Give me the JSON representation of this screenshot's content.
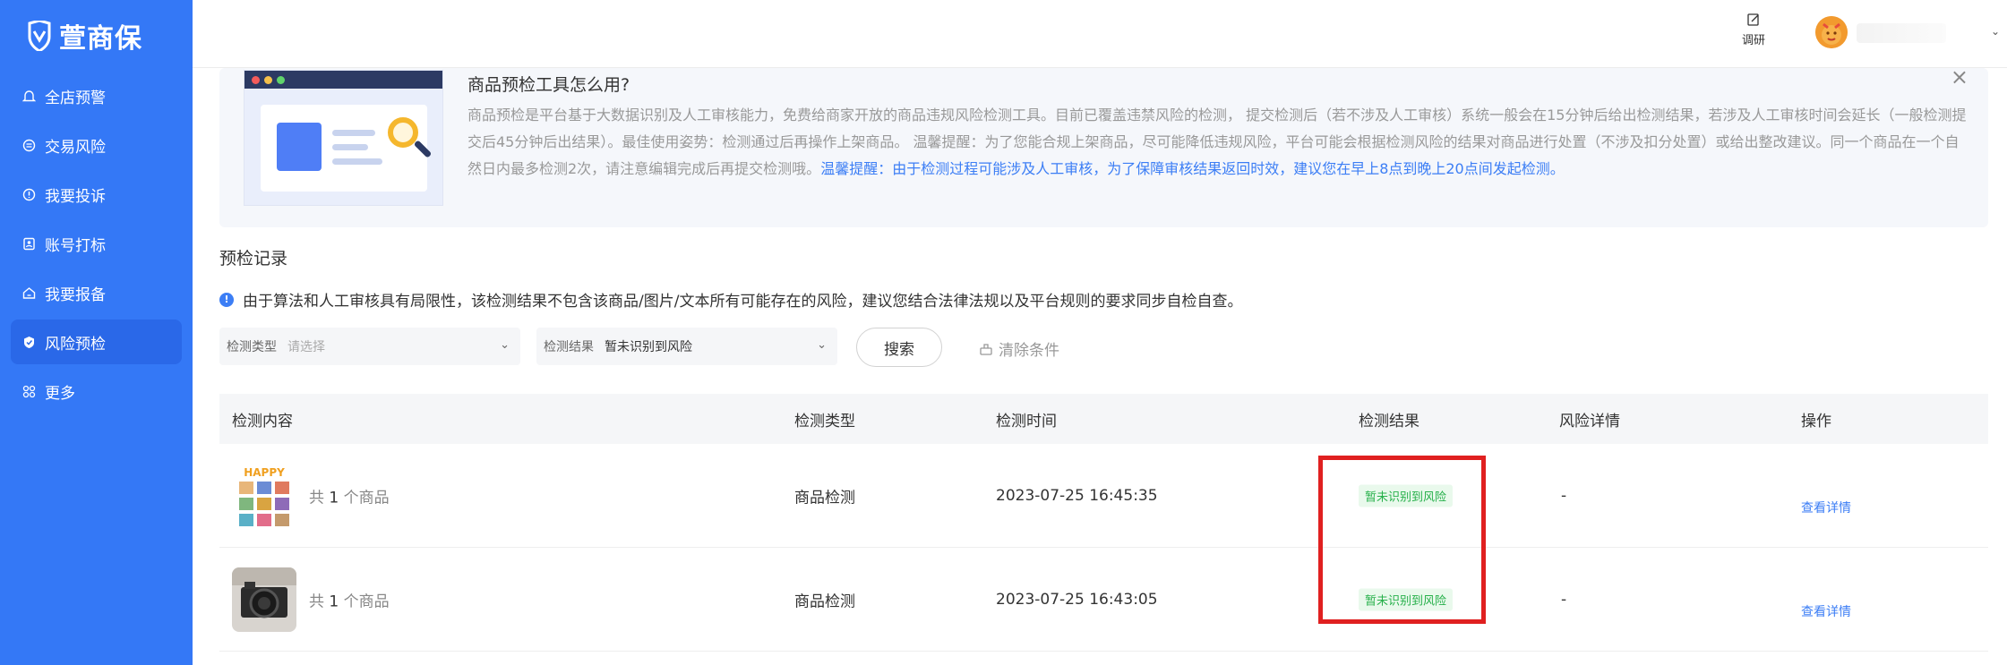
{
  "sidebar": {
    "logo_text": "萱商保",
    "items": [
      {
        "label": "全店预警",
        "icon": "bell-icon"
      },
      {
        "label": "交易风险",
        "icon": "exchange-icon"
      },
      {
        "label": "我要投诉",
        "icon": "alert-icon"
      },
      {
        "label": "账号打标",
        "icon": "tag-icon"
      },
      {
        "label": "我要报备",
        "icon": "home-icon"
      },
      {
        "label": "风险预检",
        "icon": "shield-icon",
        "active": true
      },
      {
        "label": "更多",
        "icon": "grid-icon"
      }
    ]
  },
  "header": {
    "survey_label": "调研"
  },
  "tip": {
    "title": "商品预检工具怎么用?",
    "body": "商品预检是平台基于大数据识别及人工审核能力，免费给商家开放的商品违规风险检测工具。目前已覆盖违禁风险的检测， 提交检测后（若不涉及人工审核）系统一般会在15分钟后给出检测结果，若涉及人工审核时间会延长（一般检测提交后45分钟后出结果）。最佳使用姿势：检测通过后再操作上架商品。 温馨提醒：为了您能合规上架商品，尽可能降低违规风险，平台可能会根据检测风险的结果对商品进行处置（不涉及扣分处置）或给出整改建议。同一个商品在一个自然日内最多检测2次，请注意编辑完成后再提交检测哦。",
    "highlight": "温馨提醒：由于检测过程可能涉及人工审核，为了保障审核结果返回时效，建议您在早上8点到晚上20点间发起检测。",
    "close_label": "×"
  },
  "records": {
    "title": "预检记录",
    "notice": "由于算法和人工审核具有局限性，该检测结果不包含该商品/图片/文本所有可能存在的风险，建议您结合法律法规以及平台规则的要求同步自检自查。"
  },
  "filters": {
    "type_label": "检测类型",
    "type_placeholder": "请选择",
    "result_label": "检测结果",
    "result_value": "暂未识别到风险",
    "search_label": "搜索",
    "clear_label": "清除条件"
  },
  "table": {
    "columns": [
      "检测内容",
      "检测类型",
      "检测时间",
      "检测结果",
      "风险详情",
      "操作"
    ],
    "rows": [
      {
        "count_prefix": "共",
        "count": "1",
        "count_suffix": "个商品",
        "type": "商品检测",
        "time": "2023-07-25 16:45:35",
        "result": "暂未识别到风险",
        "detail": "-",
        "action": "查看详情",
        "thumb": "happy-collage"
      },
      {
        "count_prefix": "共",
        "count": "1",
        "count_suffix": "个商品",
        "type": "商品检测",
        "time": "2023-07-25 16:43:05",
        "result": "暂未识别到风险",
        "detail": "-",
        "action": "查看详情",
        "thumb": "camera-photo"
      }
    ]
  },
  "colors": {
    "sidebar": "#3478f6",
    "accent": "#3c7ef5",
    "success": "#26b04a",
    "highlight_box": "#e02020"
  }
}
